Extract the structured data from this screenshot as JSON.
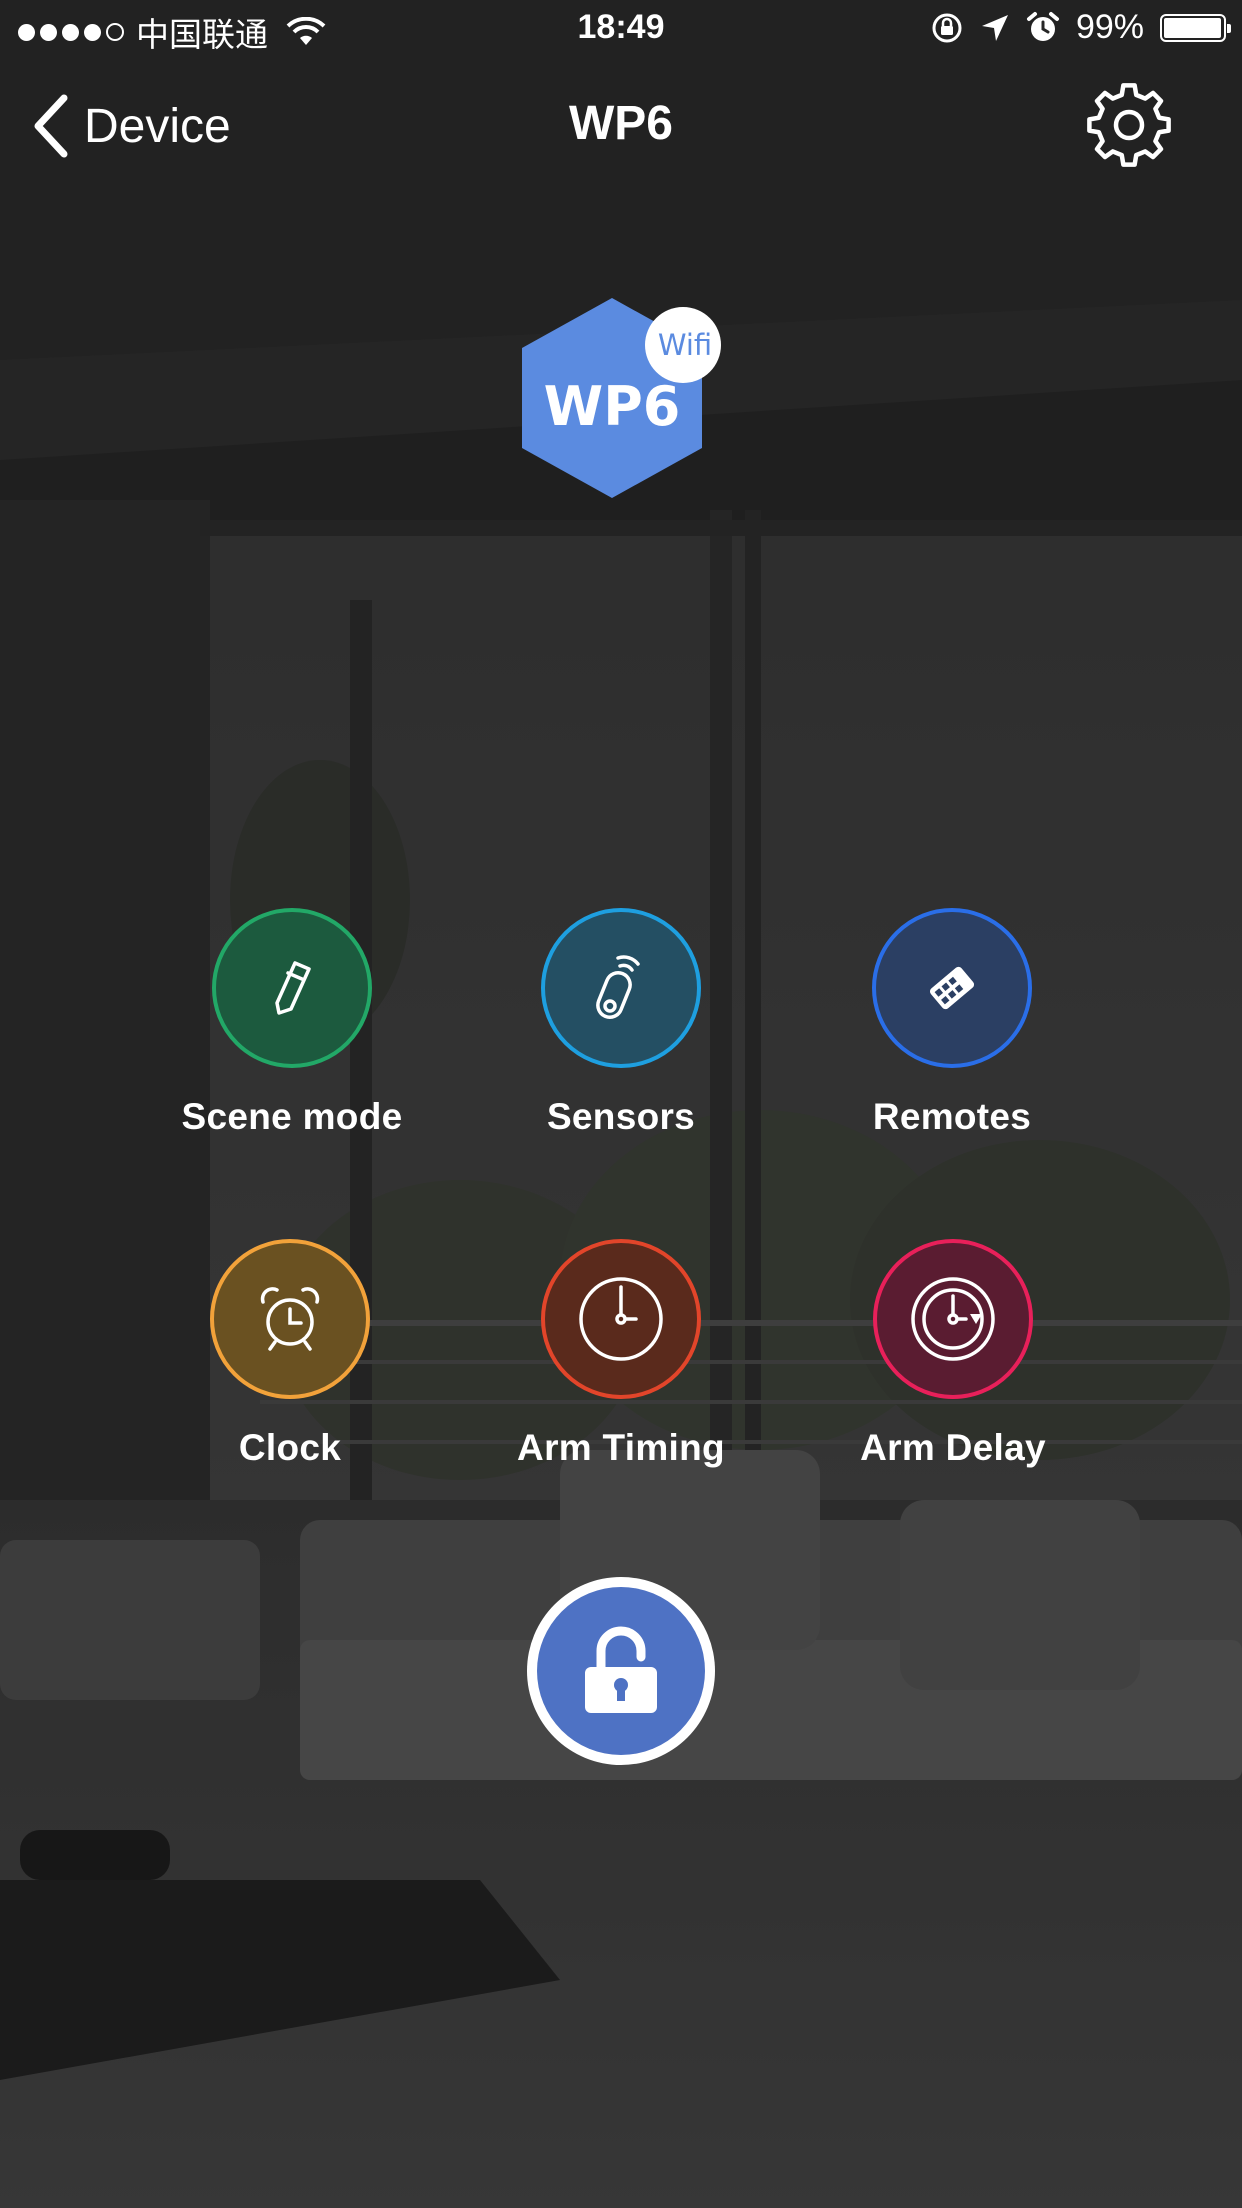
{
  "status_bar": {
    "signal_dots_filled": 4,
    "signal_dots_total": 5,
    "carrier": "中国联通",
    "wifi_icon": "wifi-icon",
    "time": "18:49",
    "orientation_lock_icon": "orientation-lock-icon",
    "location_icon": "location-arrow-icon",
    "alarm_icon": "alarm-icon",
    "battery_percent": "99%",
    "battery_level": 0.99
  },
  "nav": {
    "back_label": "Device",
    "title": "WP6",
    "settings_icon": "gear-icon"
  },
  "device_logo": {
    "name": "WP6",
    "badge": "Wifi",
    "color": "#5b8be0"
  },
  "features": [
    {
      "id": "scene-mode",
      "label": "Scene mode",
      "icon": "pencil-icon",
      "ring_color": "#22a867",
      "fill_color": "#1c5a3e"
    },
    {
      "id": "sensors",
      "label": "Sensors",
      "icon": "sensor-icon",
      "ring_color": "#1e9fe0",
      "fill_color": "#244f63"
    },
    {
      "id": "remotes",
      "label": "Remotes",
      "icon": "remote-icon",
      "ring_color": "#2a6ee8",
      "fill_color": "#2b3f63"
    },
    {
      "id": "clock",
      "label": "Clock",
      "icon": "alarm-clock-icon",
      "ring_color": "#f2a23a",
      "fill_color": "#6a5121"
    },
    {
      "id": "arm-timing",
      "label": "Arm Timing",
      "icon": "clock-icon",
      "ring_color": "#e2452a",
      "fill_color": "#5a2a1c"
    },
    {
      "id": "arm-delay",
      "label": "Arm Delay",
      "icon": "clock-delay-icon",
      "ring_color": "#e8205a",
      "fill_color": "#5a1c31"
    }
  ],
  "lock_button": {
    "state_icon": "unlocked-padlock-icon",
    "color": "#4e72c4"
  }
}
